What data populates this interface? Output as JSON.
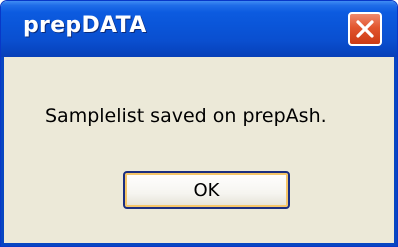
{
  "window": {
    "title": "prepDATA",
    "close_icon": "close-x-icon"
  },
  "dialog": {
    "message": "Samplelist saved on prepAsh.",
    "ok_label": "OK"
  },
  "colors": {
    "title_bar": "#0a55d8",
    "body": "#ece9d8",
    "close_button": "#e2552e",
    "ok_focus_ring": "#f5c66a"
  }
}
